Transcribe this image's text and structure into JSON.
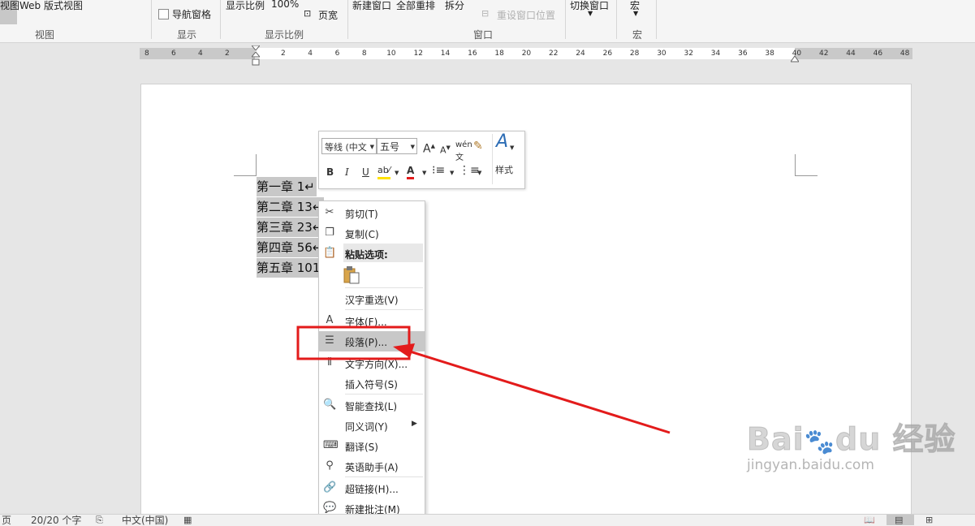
{
  "ribbon": {
    "view_btn": "视图",
    "web_layout": "Web 版式视图",
    "nav_pane": "导航窗格",
    "zoom_label": "显示比例",
    "zoom_value": "100%",
    "page_width": "页宽",
    "new_window": "新建窗口",
    "arrange_all": "全部重排",
    "split": "拆分",
    "reset_window": "重设窗口位置",
    "switch_window": "切换窗口",
    "macros": "宏",
    "groups": {
      "view": "视图",
      "show": "显示",
      "zoom": "显示比例",
      "window": "窗口",
      "macro": "宏"
    }
  },
  "ruler": {
    "left_ticks": [
      "8",
      "6",
      "4",
      "2"
    ],
    "ticks": [
      "2",
      "4",
      "6",
      "8",
      "10",
      "12",
      "14",
      "16",
      "18",
      "20",
      "22",
      "24",
      "26",
      "28",
      "30",
      "32",
      "34",
      "36",
      "38",
      "40",
      "42",
      "44",
      "46",
      "48"
    ]
  },
  "document": {
    "lines": [
      "第一章 1↵",
      "第二章 13↵",
      "第三章 23↵",
      "第四章 56↵",
      "第五章 101"
    ]
  },
  "mini_toolbar": {
    "font_name": "等线 (中文",
    "font_size": "五号",
    "styles_label": "样式",
    "bold": "B",
    "italic": "I",
    "underline": "U",
    "font_color_letter": "A"
  },
  "context_menu": {
    "cut": "剪切(T)",
    "copy": "复制(C)",
    "paste_options": "粘贴选项:",
    "reconvert": "汉字重选(V)",
    "font": "字体(F)...",
    "paragraph": "段落(P)...",
    "text_direction": "文字方向(X)...",
    "insert_symbol": "插入符号(S)",
    "smart_lookup": "智能查找(L)",
    "synonyms": "同义词(Y)",
    "translate": "翻译(S)",
    "english_assistant": "英语助手(A)",
    "hyperlink": "超链接(H)...",
    "new_comment": "新建批注(M)"
  },
  "statusbar": {
    "page": "页",
    "word_count": "20/20 个字",
    "language": "中文(中国)"
  },
  "watermark": {
    "brand": "Bai du 经验",
    "url": "jingyan.baidu.com"
  },
  "colors": {
    "annotation_red": "#e31b1b",
    "selection_gray": "#c8c8c8",
    "menu_highlight": "#c8c8c8"
  }
}
